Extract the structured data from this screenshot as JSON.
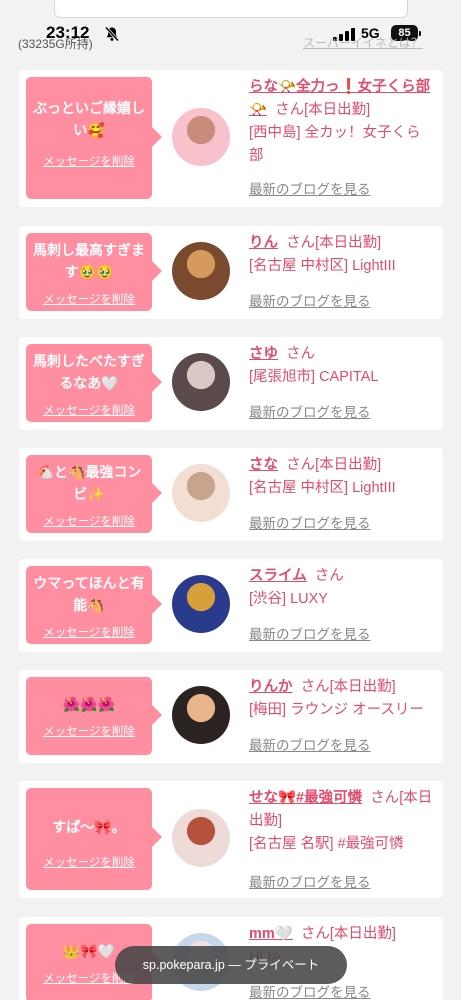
{
  "status_bar": {
    "time": "23:12",
    "network": "5G",
    "battery": "85"
  },
  "header": {
    "coins": "(33235G所持)",
    "super_link": "スーパーイイネとは？"
  },
  "cards": [
    {
      "message": "ぶっといご縁嬉しい🥰",
      "delete_label": "メッセージを削除",
      "name_line": "らな📯全力っ❗女子くら部📯",
      "san": "さん",
      "status": "[本日出勤]",
      "area_line": "[西中島] 全カッ！女子くら部",
      "blog_link": "最新のブログを見る",
      "avatar_colors": [
        "#f7c2cc",
        "#c98b7a"
      ]
    },
    {
      "message": "馬刺し最高すぎます🥹🥹",
      "delete_label": "メッセージを削除",
      "name_line": "りん",
      "san": "さん",
      "status": "[本日出勤]",
      "area_line": "[名古屋 中村区] LightIII",
      "blog_link": "最新のブログを見る",
      "avatar_colors": [
        "#7a4a2e",
        "#d69a5c"
      ]
    },
    {
      "message": "馬刺したべたすぎるなあ🤍",
      "delete_label": "メッセージを削除",
      "name_line": "さゆ",
      "san": "さん",
      "status": "",
      "area_line": "[尾張旭市] CAPITAL",
      "blog_link": "最新のブログを見る",
      "avatar_colors": [
        "#5a4a4c",
        "#d9c8c6"
      ]
    },
    {
      "message": "🐔と🐴最強コンビ✨",
      "delete_label": "メッセージを削除",
      "name_line": "さな",
      "san": "さん",
      "status": "[本日出勤]",
      "area_line": "[名古屋 中村区] LightIII",
      "blog_link": "最新のブログを見る",
      "avatar_colors": [
        "#f2ded2",
        "#c9a48c"
      ]
    },
    {
      "message": "ウマってほんと有能🐴",
      "delete_label": "メッセージを削除",
      "name_line": "スライム",
      "san": "さん",
      "status": "",
      "area_line": "[渋谷] LUXY",
      "blog_link": "最新のブログを見る",
      "avatar_colors": [
        "#2a3a8c",
        "#d8a03a"
      ]
    },
    {
      "message": "🌺🌺🌺",
      "delete_label": "メッセージを削除",
      "name_line": "りんか",
      "san": "さん",
      "status": "[本日出勤]",
      "area_line": "[梅田] ラウンジ オースリー",
      "blog_link": "最新のブログを見る",
      "avatar_colors": [
        "#2b2322",
        "#e8b48a"
      ]
    },
    {
      "message": "すぱ〜🎀。",
      "delete_label": "メッセージを削除",
      "name_line": "せな🎀#最強可憐",
      "san": "さん",
      "status": "[本日出勤]",
      "area_line": "[名古屋 名駅] #最強可憐",
      "blog_link": "最新のブログを見る",
      "avatar_colors": [
        "#eedbd8",
        "#b5523e"
      ]
    },
    {
      "message": "👑🎀🤍",
      "delete_label": "メッセージを削除",
      "name_line": "mm🤍",
      "san": "さん",
      "status": "[本日出勤]",
      "area_line": "HLIA",
      "blog_link": "最新のブログを見る",
      "avatar_colors": [
        "#c8d8ea",
        "#f0e2e6"
      ]
    }
  ],
  "url_bar": {
    "text": "sp.pokepara.jp — プライベート"
  }
}
